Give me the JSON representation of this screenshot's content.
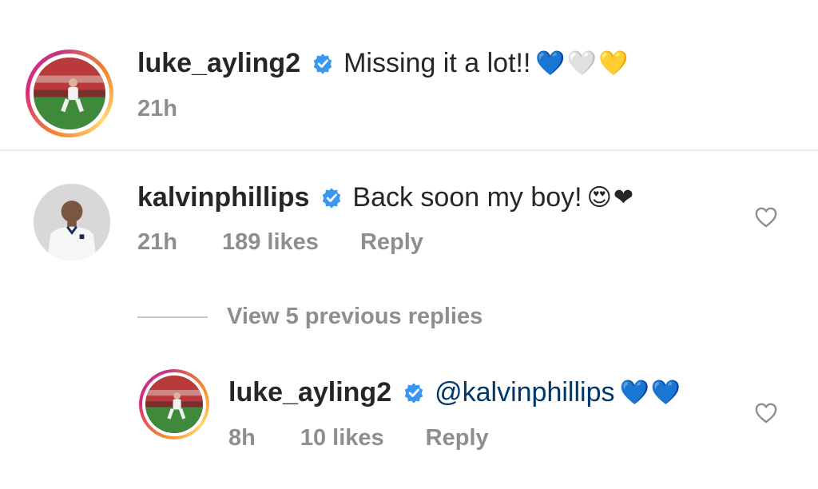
{
  "comment1": {
    "username": "luke_ayling2",
    "text": "Missing it a lot!!",
    "emoji": "💙🤍💛",
    "time": "21h"
  },
  "comment2": {
    "username": "kalvinphillips",
    "text": "Back soon my boy!",
    "emoji": "😍❤",
    "time": "21h",
    "likes": "189 likes",
    "reply": "Reply"
  },
  "view_replies": {
    "label": "View 5 previous replies"
  },
  "reply1": {
    "username": "luke_ayling2",
    "mention": "@kalvinphillips",
    "emoji": "💙💙",
    "time": "8h",
    "likes": "10 likes",
    "reply": "Reply"
  },
  "colors": {
    "verified": "#3897f0",
    "mention": "#00376b",
    "meta": "#8e8e8e"
  },
  "icons": [
    "verified-badge-icon",
    "heart-icon"
  ]
}
